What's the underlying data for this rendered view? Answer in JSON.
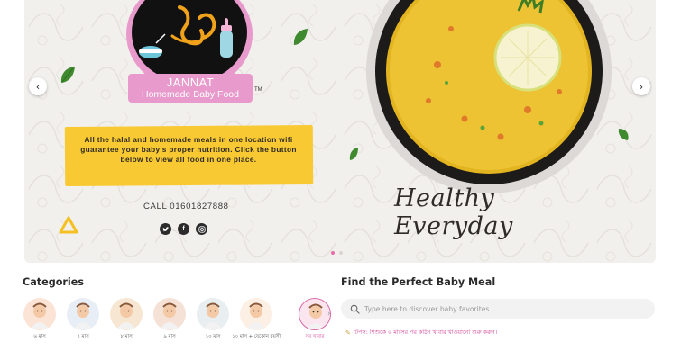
{
  "hero": {
    "brand_name": "JANNAT",
    "brand_sub": "Homemade Baby Food",
    "trademark": "TM",
    "tagline": "All the halal and homemade meals in one location wifi guarantee your baby's proper nutrition. Click the button below to view all food in one place.",
    "call": "CALL 01601827888",
    "script_text": "Healthy Everyday",
    "prev_arrow": "‹",
    "next_arrow": "›",
    "socials": [
      "twitter-icon",
      "facebook-icon",
      "instagram-icon"
    ],
    "slides": 2,
    "active_slide": 1,
    "colors": {
      "accent": "#e79acb",
      "yellow": "#f9c933",
      "dot_active": "#e56fa8"
    }
  },
  "categories": {
    "title": "Categories",
    "items": [
      {
        "label": "৬ মাস",
        "icon": "baby-6-months"
      },
      {
        "label": "৭ মাস",
        "icon": "baby-7-months"
      },
      {
        "label": "৮ মাস",
        "icon": "baby-8-months"
      },
      {
        "label": "৯ মাস",
        "icon": "baby-9-months"
      },
      {
        "label": "১০ মাস",
        "icon": "baby-10-months"
      },
      {
        "label": "১০ মাস + যেকোন বয়সী",
        "icon": "baby-10-plus"
      },
      {
        "label": "সব খাবার",
        "icon": "all-foods"
      }
    ],
    "selected_index": 6
  },
  "finder": {
    "title": "Find the Perfect Baby Meal",
    "search_placeholder": "Type here to discover baby favorites...",
    "tip": "টিপস: শিশুকে ৬ মাসের পর কঠিন খাবার খাওয়ানো শুরু করুন।"
  }
}
